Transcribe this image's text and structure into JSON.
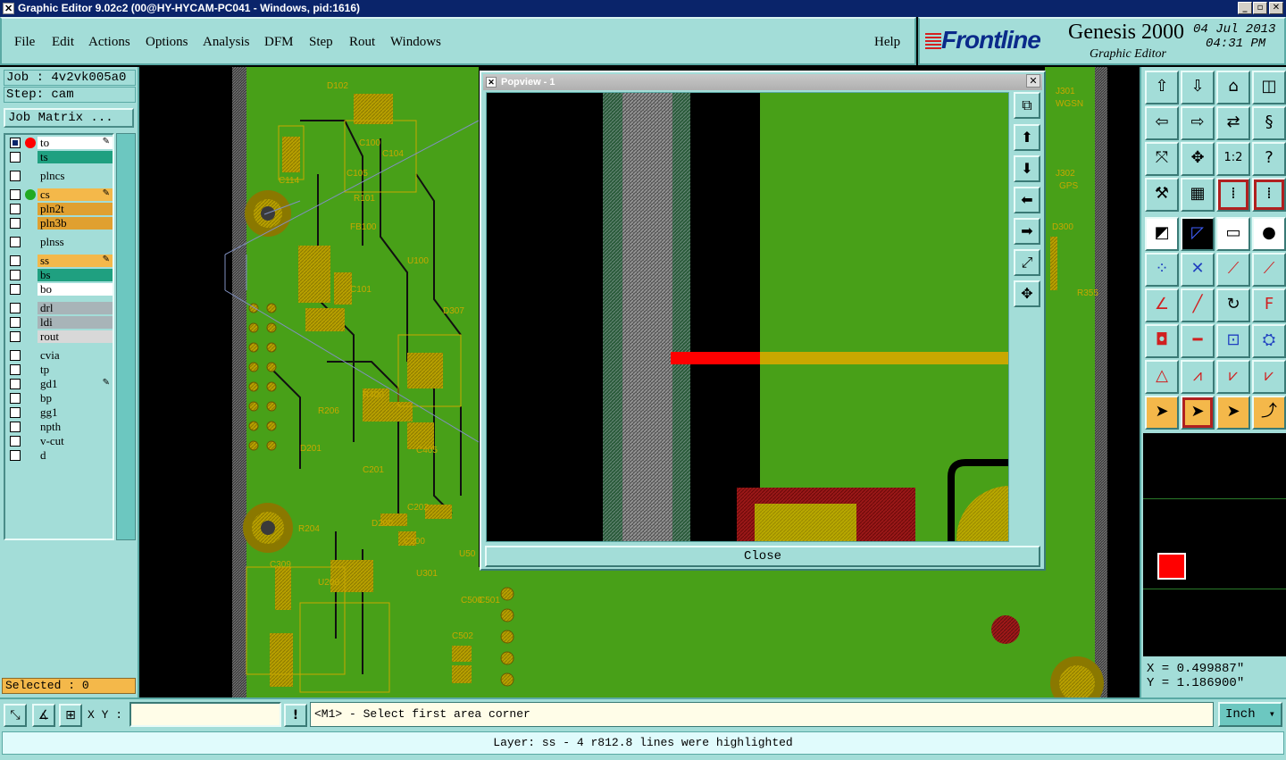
{
  "window": {
    "title": "Graphic Editor 9.02c2 (00@HY-HYCAM-PC041 - Windows, pid:1616)"
  },
  "menu": {
    "items": [
      "File",
      "Edit",
      "Actions",
      "Options",
      "Analysis",
      "DFM",
      "Step",
      "Rout",
      "Windows"
    ],
    "help": "Help"
  },
  "brand": {
    "logo": "Frontline",
    "product": "Genesis 2000",
    "subtitle": "Graphic Editor",
    "date": "04 Jul 2013",
    "time": "04:31 PM"
  },
  "job": {
    "job_label": "Job : 4v2vk005a0",
    "step_label": "Step: cam",
    "matrix_button": "Job Matrix ..."
  },
  "layers": [
    {
      "name": "to",
      "color": "#ffffff",
      "dot": "#ff0000",
      "checked": true,
      "edit": true
    },
    {
      "name": "ts",
      "color": "#1fa080",
      "dot": "",
      "checked": false,
      "edit": false
    },
    {
      "name": "plncs",
      "color": "#a3ddd8",
      "dot": "",
      "checked": false,
      "edit": false
    },
    {
      "name": "cs",
      "color": "#f4b84a",
      "dot": "#22aa22",
      "checked": false,
      "edit": true
    },
    {
      "name": "pln2t",
      "color": "#e0a030",
      "dot": "",
      "checked": false,
      "edit": false
    },
    {
      "name": "pln3b",
      "color": "#e0a030",
      "dot": "",
      "checked": false,
      "edit": false
    },
    {
      "name": "plnss",
      "color": "#a3ddd8",
      "dot": "",
      "checked": false,
      "edit": false
    },
    {
      "name": "ss",
      "color": "#f4b84a",
      "dot": "",
      "checked": false,
      "edit": true
    },
    {
      "name": "bs",
      "color": "#1fa080",
      "dot": "",
      "checked": false,
      "edit": false
    },
    {
      "name": "bo",
      "color": "#ffffff",
      "dot": "",
      "checked": false,
      "edit": false
    },
    {
      "name": "drl",
      "color": "#a8b4b8",
      "dot": "",
      "checked": false,
      "edit": false
    },
    {
      "name": "ldi",
      "color": "#a8b4b8",
      "dot": "",
      "checked": false,
      "edit": false
    },
    {
      "name": "rout",
      "color": "#d8d8d8",
      "dot": "",
      "checked": false,
      "edit": false
    },
    {
      "name": "cvia",
      "color": "#a3ddd8",
      "dot": "",
      "checked": false,
      "edit": false
    },
    {
      "name": "tp",
      "color": "#a3ddd8",
      "dot": "",
      "checked": false,
      "edit": false
    },
    {
      "name": "gd1",
      "color": "#a3ddd8",
      "dot": "",
      "checked": false,
      "edit": true
    },
    {
      "name": "bp",
      "color": "#a3ddd8",
      "dot": "",
      "checked": false,
      "edit": false
    },
    {
      "name": "gg1",
      "color": "#a3ddd8",
      "dot": "",
      "checked": false,
      "edit": false
    },
    {
      "name": "npth",
      "color": "#a3ddd8",
      "dot": "",
      "checked": false,
      "edit": false
    },
    {
      "name": "v-cut",
      "color": "#a3ddd8",
      "dot": "",
      "checked": false,
      "edit": false
    },
    {
      "name": "d",
      "color": "#a3ddd8",
      "dot": "",
      "checked": false,
      "edit": false
    }
  ],
  "selected": "Selected : 0",
  "popview": {
    "title": "Popview - 1",
    "close_label": "Close"
  },
  "pcb_labels": [
    "D102",
    "C100",
    "C104",
    "C105",
    "C114",
    "R101",
    "FB100",
    "U100",
    "C101",
    "R400",
    "R206",
    "D201",
    "C201",
    "C202",
    "C405",
    "R204",
    "D200",
    "C200",
    "C309",
    "U200",
    "U301",
    "C502",
    "C500",
    "C501",
    "U50",
    "D300",
    "J301",
    "WGSN",
    "J302",
    "GPS",
    "R355",
    "D307"
  ],
  "coords": {
    "x": "X = 0.499887\"",
    "y": "Y = 1.186900\""
  },
  "bottom": {
    "xy_label": "X Y :",
    "xy_value": "",
    "prompt": "<M1> - Select first area corner",
    "unit": "Inch",
    "status": "Layer: ss - 4 r812.8 lines were highlighted"
  },
  "colors": {
    "panel": "#a3ddd8",
    "board": "#48a018",
    "copper": "#c8a800",
    "highlight": "#ff0000"
  }
}
